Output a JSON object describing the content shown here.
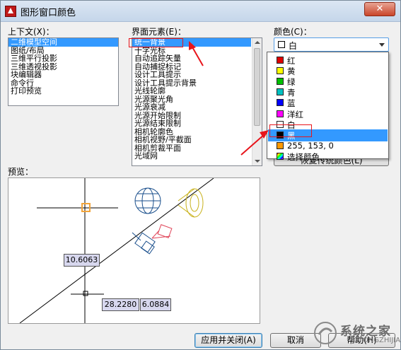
{
  "window": {
    "title": "图形窗口颜色",
    "close_glyph": "✕"
  },
  "context": {
    "label": "上下文(X)：",
    "items": [
      "二维模型空间",
      "图纸/布局",
      "三维平行投影",
      "三维透视投影",
      "块编辑器",
      "命令行",
      "打印预览"
    ],
    "selected_index": 0
  },
  "elements": {
    "label": "界面元素(E)：",
    "items": [
      "统一背景",
      "十字光标",
      "自动追踪矢量",
      "自动捕捉标记",
      "设计工具提示",
      "设计工具提示背景",
      "光线轮廓",
      "光源聚光角",
      "光源衰减",
      "光源开始限制",
      "光源结束限制",
      "相机轮廓色",
      "相机视野/平截面",
      "相机剪裁平面",
      "光域网"
    ],
    "selected_index": 0
  },
  "color": {
    "label": "颜色(C)：",
    "selected": "白",
    "selected_swatch": "#ffffff",
    "options": [
      {
        "label": "红",
        "swatch": "#e00000"
      },
      {
        "label": "黄",
        "swatch": "#ffff00"
      },
      {
        "label": "绿",
        "swatch": "#00c000"
      },
      {
        "label": "青",
        "swatch": "#00c0c0"
      },
      {
        "label": "蓝",
        "swatch": "#0000ff"
      },
      {
        "label": "洋红",
        "swatch": "#ff00ff"
      },
      {
        "label": "白",
        "swatch": "#ffffff"
      },
      {
        "label": "黑",
        "swatch": "#000000"
      },
      {
        "label": "255, 153, 0",
        "swatch": "#ff9900"
      },
      {
        "label": "选择颜色...",
        "swatch": "gradient"
      }
    ],
    "highlighted_index": 7
  },
  "restore_button": "恢复传统颜色(L)",
  "preview": {
    "label": "预览：",
    "readouts": [
      "10.6063",
      "28.2280",
      "6.0884"
    ]
  },
  "buttons": {
    "apply_close": "应用并关闭(A)",
    "cancel": "取消",
    "help": "帮助(H)"
  },
  "watermark": {
    "text": "系统之家",
    "url": "XITONGZHIJIA.NET"
  },
  "accent": {
    "selection": "#3399ff",
    "annotation": "#e8141b"
  }
}
